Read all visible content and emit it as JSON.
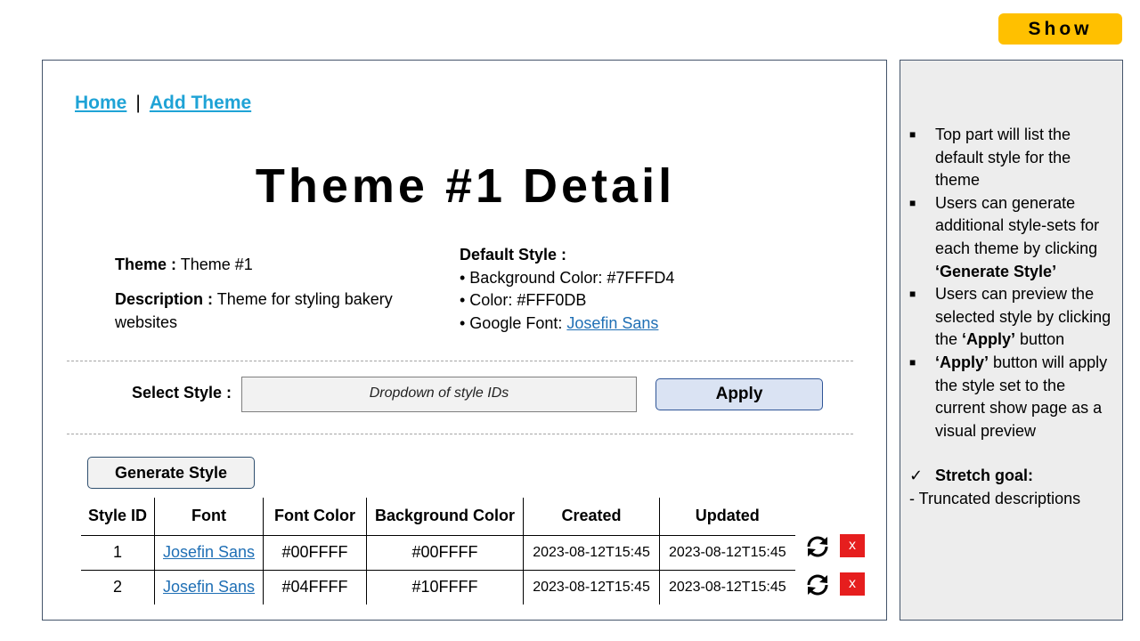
{
  "show_badge": "Show",
  "nav": {
    "home": "Home",
    "separator": "|",
    "add_theme": "Add Theme"
  },
  "title": "Theme #1 Detail",
  "theme_info": {
    "theme_label": "Theme :",
    "theme_value": "Theme #1",
    "description_label": "Description :",
    "description_value": "Theme for styling bakery websites"
  },
  "default_style": {
    "heading": "Default Style :",
    "bg_label": "• Background Color: #7FFFD4",
    "color_label": "• Color: #FFF0DB",
    "font_prefix": "• Google Font: ",
    "font_link": "Josefin Sans"
  },
  "select": {
    "label": "Select Style :",
    "placeholder": "Dropdown of style IDs",
    "apply": "Apply"
  },
  "generate_button": "Generate Style",
  "table": {
    "headers": [
      "Style ID",
      "Font",
      "Font Color",
      "Background Color",
      "Created",
      "Updated"
    ],
    "rows": [
      {
        "id": "1",
        "font": "Josefin Sans",
        "font_color": "#00FFFF",
        "bg_color": "#00FFFF",
        "created": "2023-08-12T15:45",
        "updated": "2023-08-12T15:45",
        "refresh_icon": "refresh-icon",
        "delete": "x"
      },
      {
        "id": "2",
        "font": "Josefin Sans",
        "font_color": "#04FFFF",
        "bg_color": "#10FFFF",
        "created": "2023-08-12T15:45",
        "updated": "2023-08-12T15:45",
        "refresh_icon": "refresh-icon",
        "delete": "x"
      }
    ]
  },
  "notes": {
    "items": [
      {
        "parts": [
          {
            "t": "Top part will list the default style for the theme",
            "b": false
          }
        ]
      },
      {
        "parts": [
          {
            "t": "Users can generate additional style-sets for each theme by clicking ",
            "b": false
          },
          {
            "t": "‘Generate Style’",
            "b": true
          }
        ]
      },
      {
        "parts": [
          {
            "t": "Users can preview the selected style by clicking the ",
            "b": false
          },
          {
            "t": "‘Apply’",
            "b": true
          },
          {
            "t": " button",
            "b": false
          }
        ]
      },
      {
        "parts": [
          {
            "t": "‘Apply’",
            "b": true
          },
          {
            "t": " button will apply the style set to the current show page as a visual preview",
            "b": false
          }
        ]
      }
    ],
    "stretch_check": "✓",
    "stretch_label": "Stretch goal:",
    "truncated": "-  Truncated descriptions"
  },
  "colors": {
    "badge": "#FFC000",
    "nav_link": "#1FA3D6",
    "apply_bg": "#DAE3F3",
    "delete_bg": "#E61E1E",
    "side_bg": "#EDEDED"
  }
}
